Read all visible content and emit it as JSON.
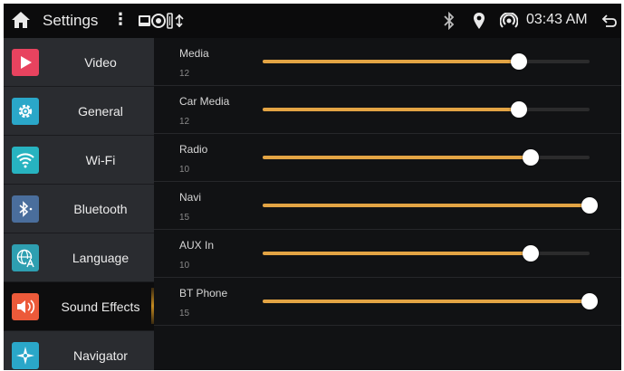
{
  "statusbar": {
    "title": "Settings",
    "menu_glyph": "⋮",
    "time": "03:43 AM"
  },
  "sidebar": {
    "items": [
      {
        "label": "Video",
        "icon": "video-icon",
        "color": "#e8435f"
      },
      {
        "label": "General",
        "icon": "gear-icon",
        "color": "#2aa7c9"
      },
      {
        "label": "Wi-Fi",
        "icon": "wifi-icon",
        "color": "#27b3c0"
      },
      {
        "label": "Bluetooth",
        "icon": "bluetooth-icon",
        "color": "#4a6e9c"
      },
      {
        "label": "Language",
        "icon": "language-icon",
        "color": "#2e9fb1"
      },
      {
        "label": "Sound Effects",
        "icon": "speaker-icon",
        "color": "#ec5a3a"
      },
      {
        "label": "Navigator",
        "icon": "compass-icon",
        "color": "#2aa7c9"
      }
    ],
    "active_index": 5
  },
  "volumes": [
    {
      "name": "Media",
      "value": "12",
      "level": 0.785
    },
    {
      "name": "Car Media",
      "value": "12",
      "level": 0.785
    },
    {
      "name": "Radio",
      "value": "10",
      "level": 0.82
    },
    {
      "name": "Navi",
      "value": "15",
      "level": 1.0
    },
    {
      "name": "AUX In",
      "value": "10",
      "level": 0.82
    },
    {
      "name": "BT Phone",
      "value": "15",
      "level": 1.0
    }
  ],
  "colors": {
    "accent": "#e3a444",
    "track": "#2b2b2c",
    "background": "#111214"
  }
}
